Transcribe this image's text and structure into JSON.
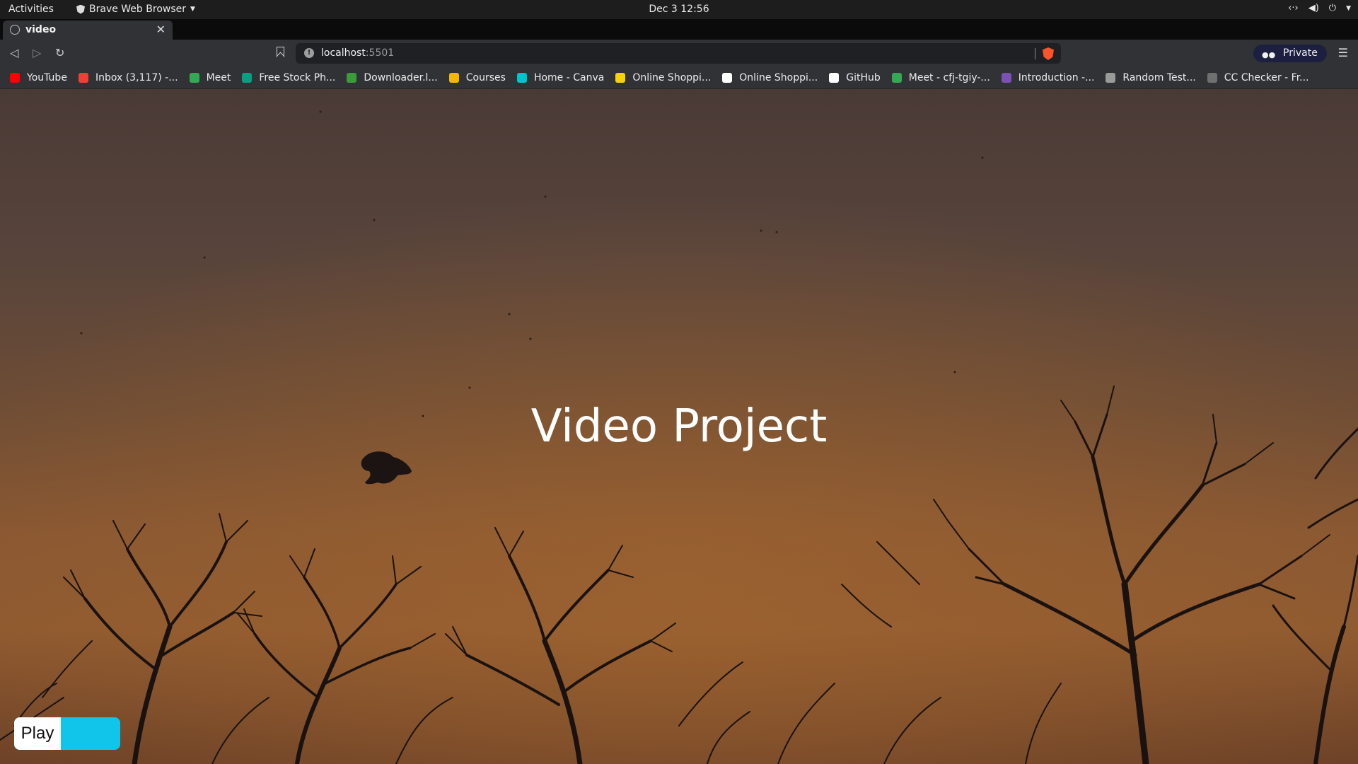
{
  "system_bar": {
    "activities": "Activities",
    "app_name": "Brave Web Browser",
    "clock": "Dec 3  12:56"
  },
  "tab": {
    "title": "video"
  },
  "address_bar": {
    "host": "localhost",
    "port": ":5501"
  },
  "private_badge": "Private",
  "bookmarks": [
    {
      "label": "YouTube",
      "icon": "youtube-icon",
      "color": "#ff0000"
    },
    {
      "label": "Inbox (3,117) -...",
      "icon": "gmail-icon",
      "color": "#ea4335"
    },
    {
      "label": "Meet",
      "icon": "meet-icon",
      "color": "#34a853"
    },
    {
      "label": "Free Stock Ph...",
      "icon": "pexels-icon",
      "color": "#05a081"
    },
    {
      "label": "Downloader.l...",
      "icon": "downloader-icon",
      "color": "#3a9b3a"
    },
    {
      "label": "Courses",
      "icon": "courses-icon",
      "color": "#f2b705"
    },
    {
      "label": "Home - Canva",
      "icon": "canva-icon",
      "color": "#00c4cc"
    },
    {
      "label": "Online Shoppi...",
      "icon": "flipkart-icon",
      "color": "#f5d20b"
    },
    {
      "label": "Online Shoppi...",
      "icon": "amazon-icon",
      "color": "#ffffff"
    },
    {
      "label": "GitHub",
      "icon": "github-icon",
      "color": "#ffffff"
    },
    {
      "label": "Meet - cfj-tgiy-...",
      "icon": "meet-icon",
      "color": "#34a853"
    },
    {
      "label": "Introduction -...",
      "icon": "bootstrap-icon",
      "color": "#7952b3"
    },
    {
      "label": "Random Test...",
      "icon": "gear-icon",
      "color": "#9a9a9a"
    },
    {
      "label": "CC Checker - Fr...",
      "icon": "cc-checker-icon",
      "color": "#707070"
    }
  ],
  "page": {
    "heading": "Video Project",
    "play_label": "Play",
    "accent_color": "#11c5ea"
  }
}
